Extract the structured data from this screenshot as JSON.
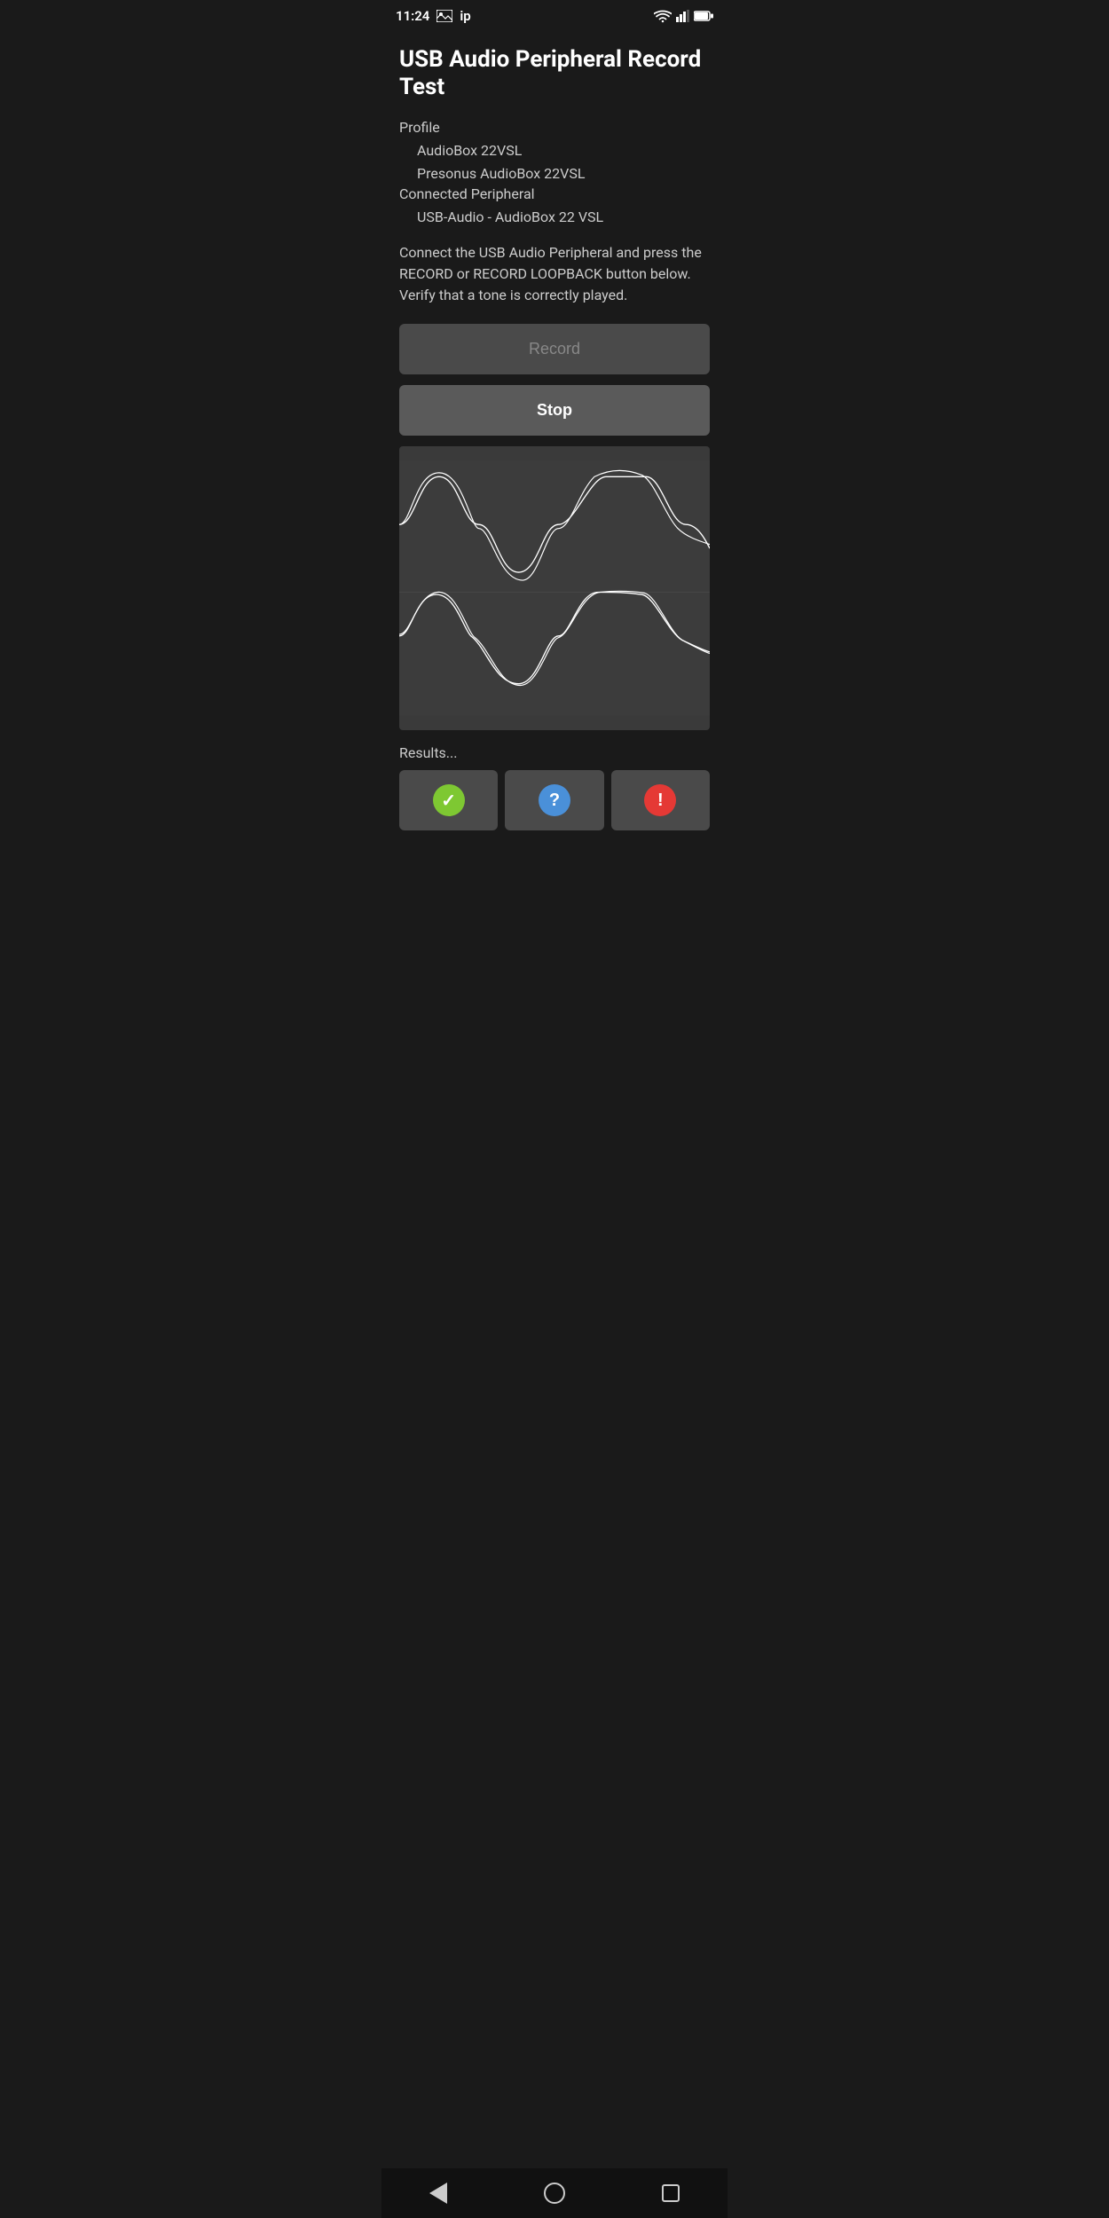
{
  "statusBar": {
    "time": "11:24",
    "networkLabel": "ip"
  },
  "page": {
    "title": "USB Audio Peripheral Record Test",
    "profileLabel": "Profile",
    "profileLine1": "AudioBox 22VSL",
    "profileLine2": "Presonus AudioBox 22VSL",
    "connectedLabel": "Connected Peripheral",
    "connectedDevice": "USB-Audio - AudioBox 22 VSL",
    "instructions": "Connect the USB Audio Peripheral and press the RECORD or RECORD LOOPBACK button below. Verify that a tone is correctly played.",
    "recordButton": "Record",
    "stopButton": "Stop",
    "resultsLabel": "Results...",
    "resultButtons": [
      {
        "type": "success",
        "colorClass": "green",
        "symbol": "✓",
        "ariaLabel": "Success result"
      },
      {
        "type": "unknown",
        "colorClass": "blue",
        "symbol": "?",
        "ariaLabel": "Unknown result"
      },
      {
        "type": "error",
        "colorClass": "red",
        "symbol": "!",
        "ariaLabel": "Error result"
      }
    ]
  },
  "nav": {
    "backLabel": "Back",
    "homeLabel": "Home",
    "recentsLabel": "Recents"
  }
}
